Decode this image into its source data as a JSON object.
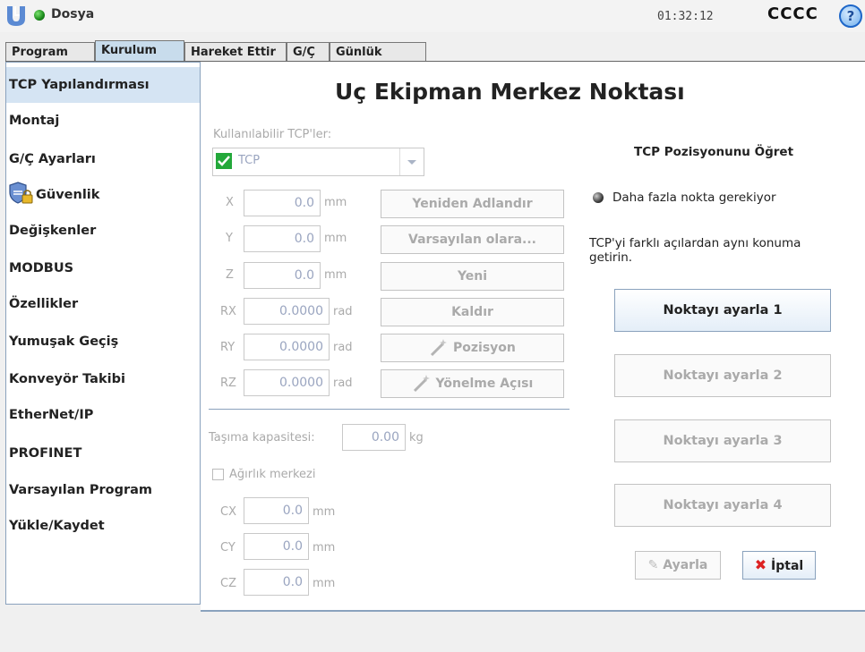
{
  "topbar": {
    "file_label": "Dosya",
    "clock": "01:32:12",
    "robot_name": "CCCC",
    "help": "?"
  },
  "tabs": [
    {
      "label": "Program"
    },
    {
      "label": "Kurulum"
    },
    {
      "label": "Hareket Ettir"
    },
    {
      "label": "G/Ç"
    },
    {
      "label": "Günlük"
    }
  ],
  "sidebar": {
    "items": [
      {
        "label": "TCP Yapılandırması"
      },
      {
        "label": "Montaj"
      },
      {
        "label": "G/Ç Ayarları"
      },
      {
        "label": "Güvenlik"
      },
      {
        "label": "Değişkenler"
      },
      {
        "label": "MODBUS"
      },
      {
        "label": "Özellikler"
      },
      {
        "label": "Yumuşak Geçiş"
      },
      {
        "label": "Konveyör Takibi"
      },
      {
        "label": "EtherNet/IP"
      },
      {
        "label": "PROFINET"
      },
      {
        "label": "Varsayılan Program"
      },
      {
        "label": "Yükle/Kaydet"
      }
    ]
  },
  "main": {
    "title": "Uç Ekipman Merkez Noktası",
    "available_label": "Kullanılabilir TCP'ler:",
    "tcp_select_value": "TCP",
    "fields": [
      {
        "axis": "X",
        "value": "0.0",
        "unit": "mm"
      },
      {
        "axis": "Y",
        "value": "0.0",
        "unit": "mm"
      },
      {
        "axis": "Z",
        "value": "0.0",
        "unit": "mm"
      },
      {
        "axis": "RX",
        "value": "0.0000",
        "unit": "rad"
      },
      {
        "axis": "RY",
        "value": "0.0000",
        "unit": "rad"
      },
      {
        "axis": "RZ",
        "value": "0.0000",
        "unit": "rad"
      }
    ],
    "buttons": {
      "rename": "Yeniden Adlandır",
      "default": "Varsayılan olara...",
      "new": "Yeni",
      "remove": "Kaldır",
      "position": "Pozisyon",
      "orientation": "Yönelme Açısı"
    },
    "payload_label": "Taşıma kapasitesi:",
    "payload_value": "0.00",
    "payload_unit": "kg",
    "cog_label": "Ağırlık merkezi",
    "cog_fields": [
      {
        "axis": "CX",
        "value": "0.0",
        "unit": "mm"
      },
      {
        "axis": "CY",
        "value": "0.0",
        "unit": "mm"
      },
      {
        "axis": "CZ",
        "value": "0.0",
        "unit": "mm"
      }
    ]
  },
  "teach": {
    "heading": "TCP Pozisyonunu Öğret",
    "status": "Daha fazla nokta gerekiyor",
    "instruction": "TCP'yi farklı açılardan aynı konuma getirin.",
    "points": [
      {
        "label": "Noktayı ayarla 1"
      },
      {
        "label": "Noktayı ayarla 2"
      },
      {
        "label": "Noktayı ayarla 3"
      },
      {
        "label": "Noktayı ayarla 4"
      }
    ],
    "set_label": "Ayarla",
    "cancel_label": "İptal"
  },
  "colors": {
    "accent": "#1d66c8",
    "status_green": "#1a8a1a",
    "sidebar_active": "#d5e4f3",
    "tab_active": "#c8dcec"
  }
}
